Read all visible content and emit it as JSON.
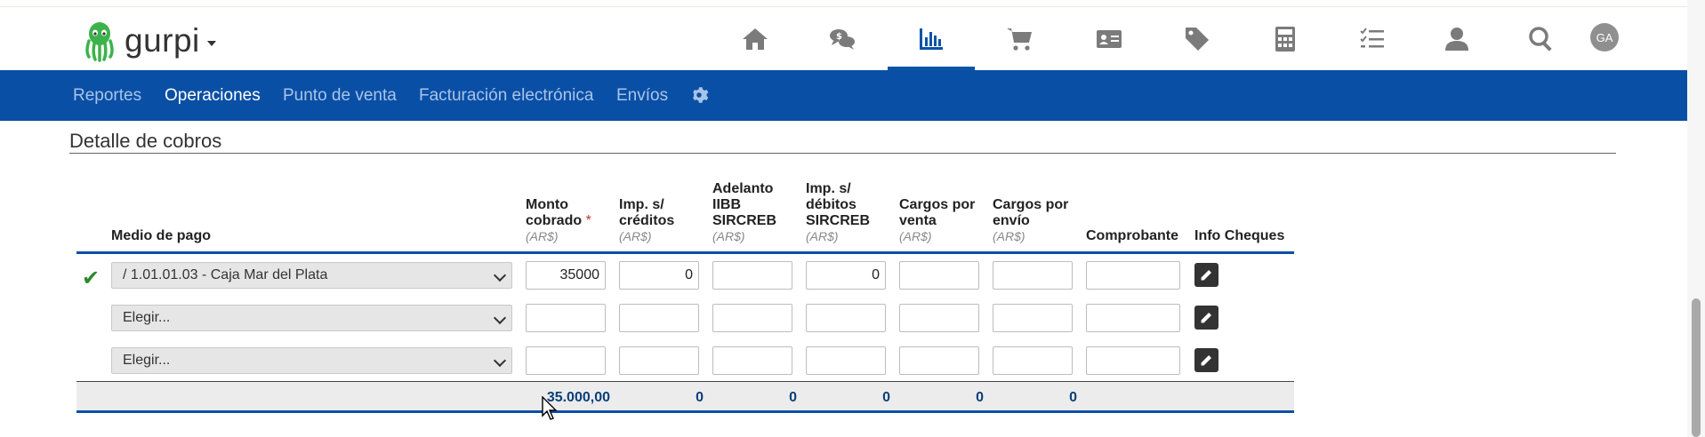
{
  "app": {
    "logo_text": "gurpi",
    "avatar_initials": "GA"
  },
  "nav_icons": [
    {
      "name": "home-icon",
      "active": false
    },
    {
      "name": "chat-money-icon",
      "active": false
    },
    {
      "name": "bar-chart-icon",
      "active": true
    },
    {
      "name": "cart-icon",
      "active": false
    },
    {
      "name": "contact-card-icon",
      "active": false
    },
    {
      "name": "tag-icon",
      "active": false
    },
    {
      "name": "calculator-icon",
      "active": false
    },
    {
      "name": "checklist-icon",
      "active": false
    },
    {
      "name": "user-icon",
      "active": false
    },
    {
      "name": "search-icon",
      "active": false
    }
  ],
  "subnav": {
    "items": [
      "Reportes",
      "Operaciones",
      "Punto de venta",
      "Facturación electrónica",
      "Envíos"
    ],
    "active": "Operaciones"
  },
  "section": {
    "title": "Detalle de cobros"
  },
  "table": {
    "headers": {
      "medio": "Medio de pago",
      "monto": "Monto cobrado",
      "monto_required": "*",
      "imp_creditos": "Imp. s/ créditos",
      "adelanto": "Adelanto IIBB SIRCREB",
      "imp_debitos": "Imp. s/ débitos SIRCREB",
      "cargos_venta": "Cargos por venta",
      "cargos_envio": "Cargos por envío",
      "comprobante": "Comprobante",
      "info_cheques": "Info Cheques",
      "unit": "(AR$)"
    },
    "rows": [
      {
        "checked": true,
        "medio": "/ 1.01.01.03 - Caja Mar del Plata",
        "monto": "35000",
        "imp_creditos": "0",
        "adelanto": "",
        "imp_debitos": "0",
        "cargos_venta": "",
        "cargos_envio": "",
        "comprobante": ""
      },
      {
        "checked": false,
        "medio": "Elegir...",
        "monto": "",
        "imp_creditos": "",
        "adelanto": "",
        "imp_debitos": "",
        "cargos_venta": "",
        "cargos_envio": "",
        "comprobante": ""
      },
      {
        "checked": false,
        "medio": "Elegir...",
        "monto": "",
        "imp_creditos": "",
        "adelanto": "",
        "imp_debitos": "",
        "cargos_venta": "",
        "cargos_envio": "",
        "comprobante": ""
      }
    ],
    "totals": {
      "monto": "35.000,00",
      "imp_creditos": "0",
      "adelanto": "0",
      "imp_debitos": "0",
      "cargos_venta": "0",
      "cargos_envio": "0"
    }
  },
  "colors": {
    "brand_blue": "#0a4fa6",
    "check_green": "#2b8a2b",
    "total_text": "#0b3f7a"
  }
}
